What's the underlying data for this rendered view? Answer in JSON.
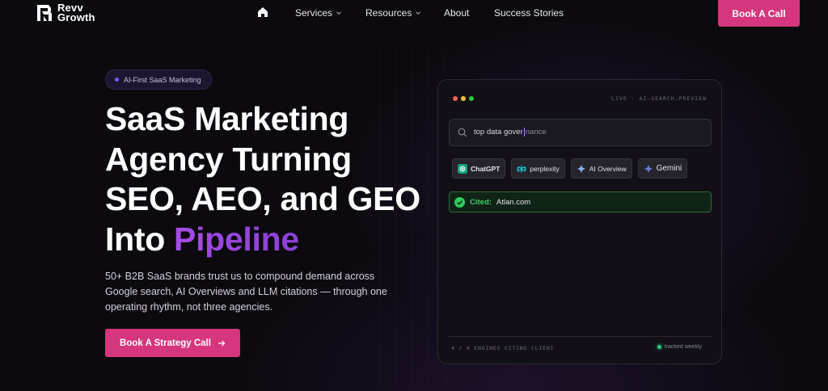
{
  "nav": {
    "logo_text_line1": "Revv",
    "logo_text_line2": "Growth",
    "links": [
      {
        "label": "Services"
      },
      {
        "label": "Resources"
      },
      {
        "label": "About"
      },
      {
        "label": "Success Stories"
      }
    ],
    "cta_label": "Book A Call"
  },
  "hero": {
    "badge": "AI-First SaaS Marketing",
    "title_lines": [
      "SaaS Marketing",
      "Agency Turning",
      "SEO, AEO, and GEO",
      "Into "
    ],
    "title_highlight": "Pipeline",
    "subtitle_lines": [
      "50+ B2B SaaS brands trust us to compound demand across",
      "Google search, AI Overviews and LLM citations — through one",
      "operating rhythm, not three agencies."
    ],
    "cta_label": "Book A Strategy Call"
  },
  "panel": {
    "live_label": "LIVE · AI-SEARCH.PREVIEW",
    "search_query_typed": "top data gover",
    "search_query_rest": "nance",
    "engines": [
      {
        "label": "ChatGPT",
        "icon": "chatgpt-icon"
      },
      {
        "label": "perplexity",
        "icon": "perplexity-icon"
      },
      {
        "label": "AI Overview",
        "icon": "sparkle-icon"
      },
      {
        "label": "Gemini",
        "icon": "gemini-icon"
      }
    ],
    "cited_label": "Cited:",
    "cited_domain": "Atlan.com",
    "engines_count": "4 / 4 ENGINES CITING CLIENT",
    "tracked_label": "tracked weekly"
  },
  "colors": {
    "accent_pink": "#d6367d",
    "highlight_purple": "#a64be6",
    "cited_green": "#3fd06a",
    "background": "#0c0a0f"
  }
}
